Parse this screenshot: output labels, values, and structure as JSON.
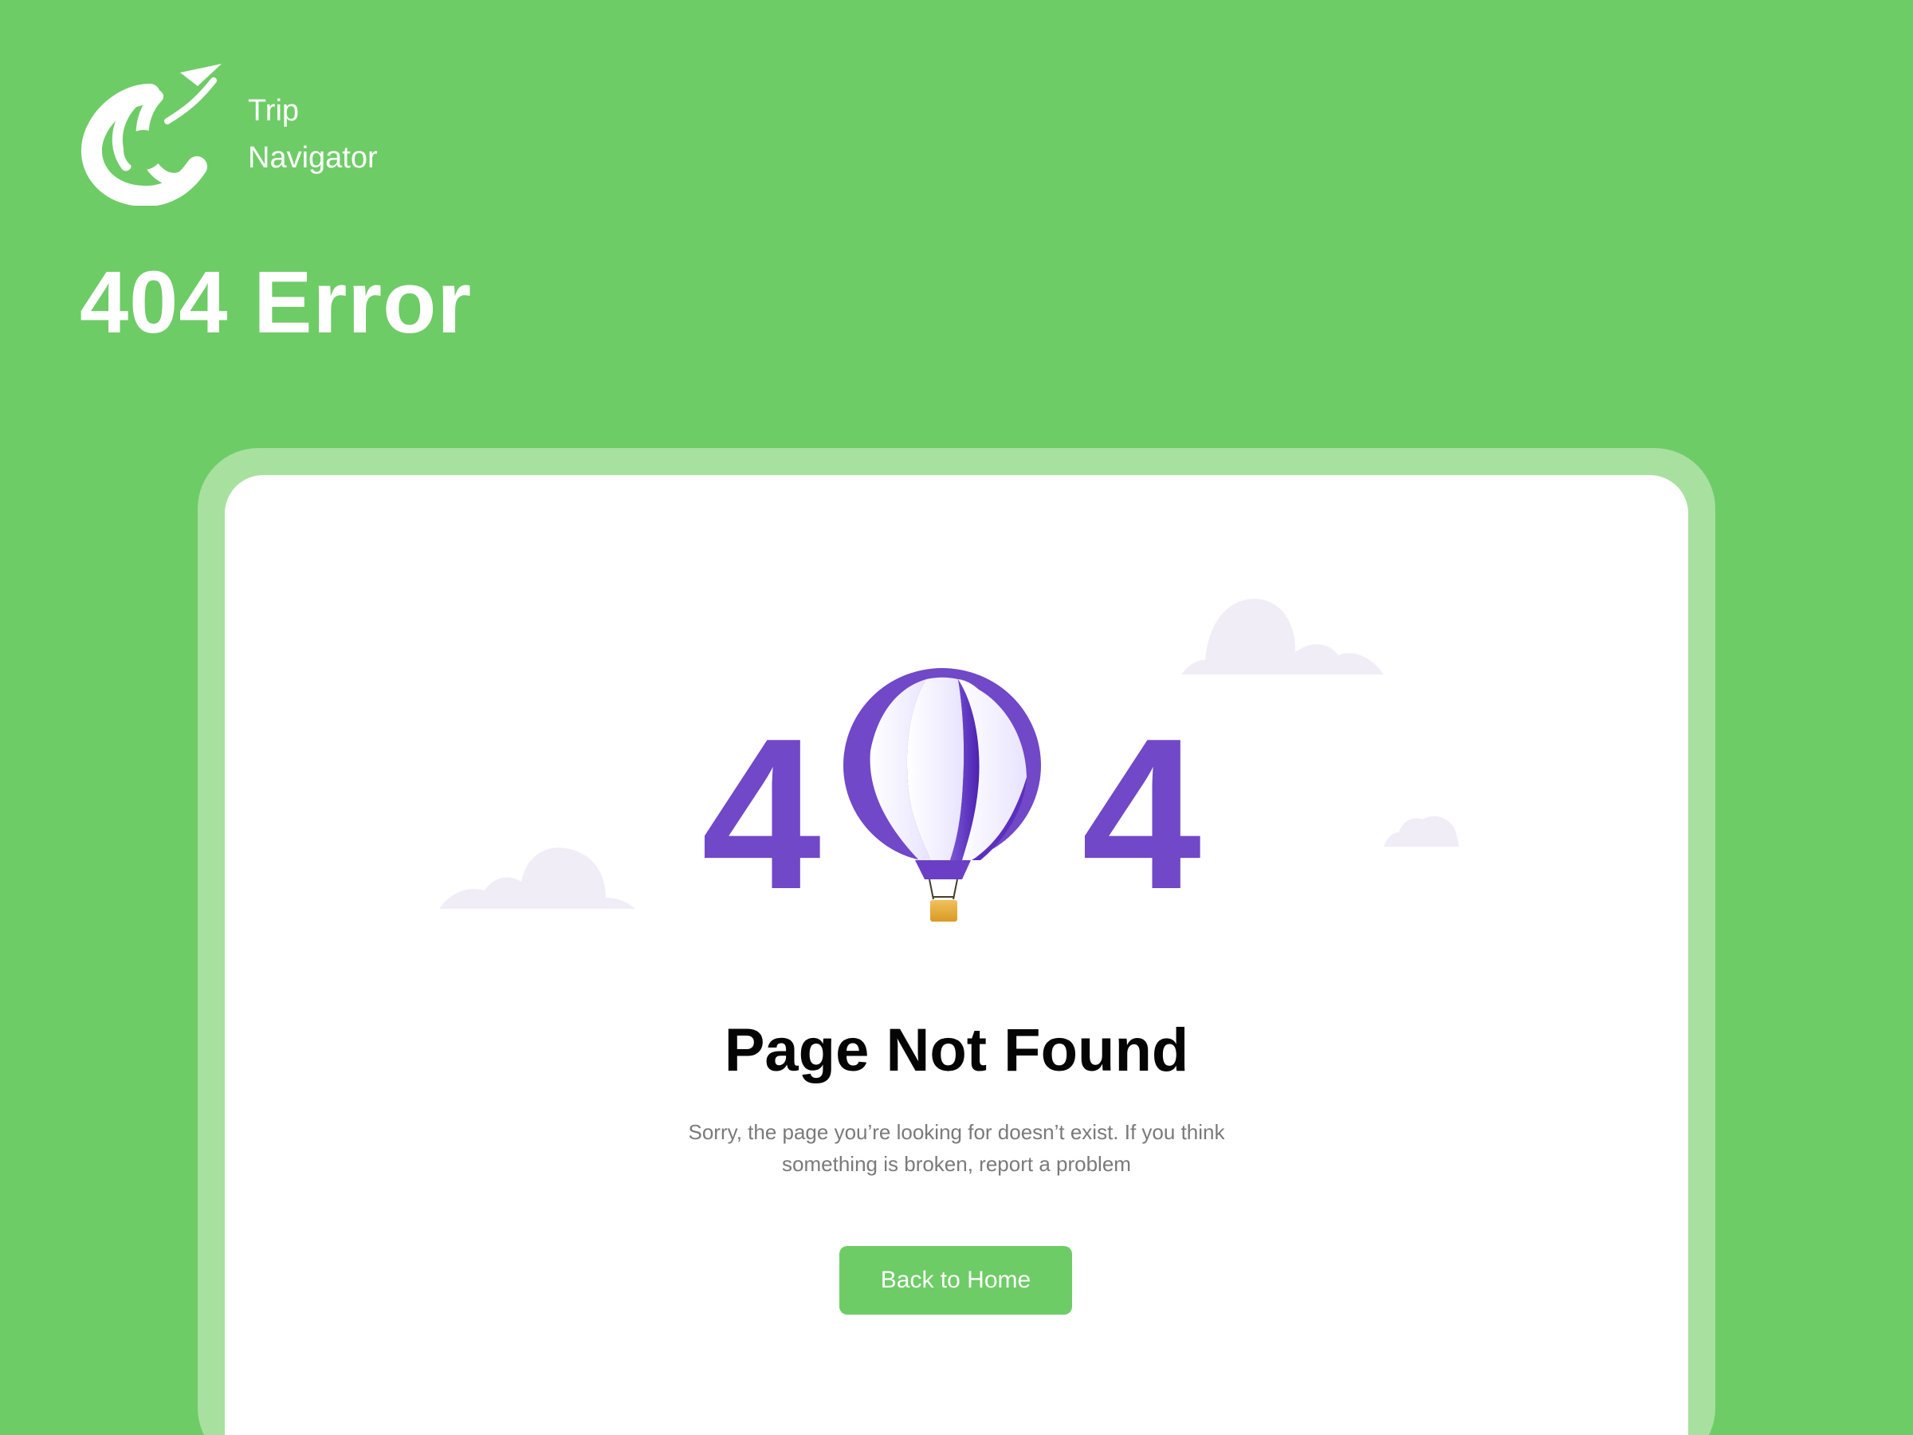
{
  "brand": {
    "line_1": "Trip",
    "line_2": "Navigator",
    "logo_icon": "trip-navigator-logo-icon"
  },
  "hero": {
    "title": "404 Error"
  },
  "error_card": {
    "error_code": {
      "left_digit": "4",
      "center_glyph": "0",
      "right_digit": "4"
    },
    "title": "Page Not Found",
    "message": "Sorry, the page you’re looking for doesn’t exist. If you think something is broken, report a problem",
    "button_label": "Back to Home",
    "illustration": {
      "balloon_icon": "hot-air-balloon-icon",
      "cloud_icon": "cloud-icon"
    }
  },
  "colors": {
    "background": "#6ecc66",
    "frame": "#a8e0a0",
    "card": "#ffffff",
    "accent_purple": "#7048c8",
    "cloud": "#f0edf7",
    "button": "#6ecc66",
    "text_dark": "#050505",
    "text_muted": "#7a7a7a"
  }
}
